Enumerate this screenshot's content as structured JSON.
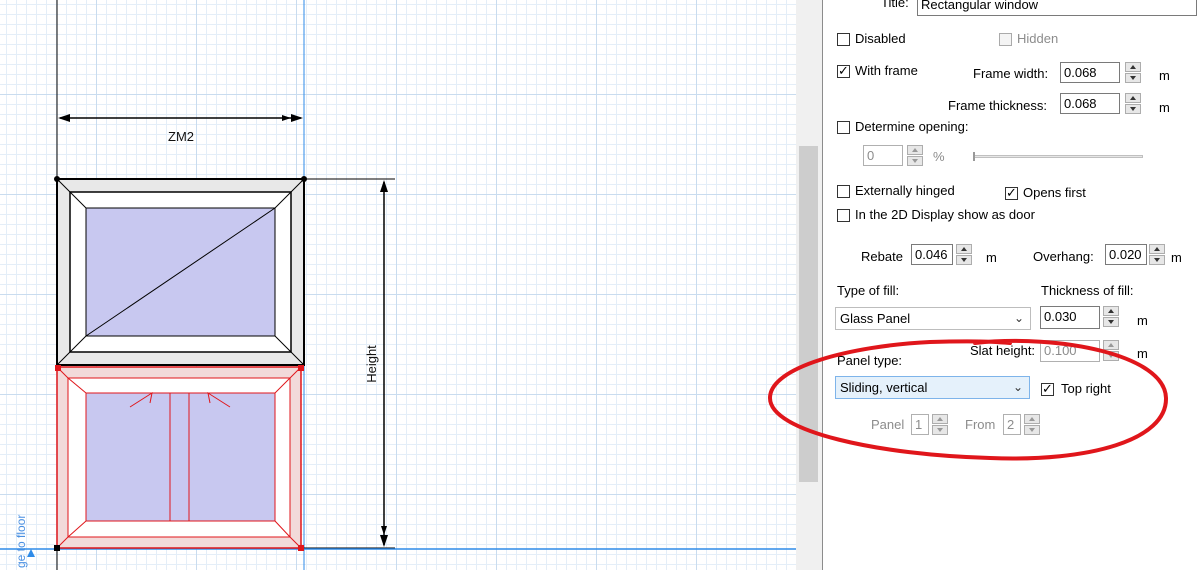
{
  "drawing": {
    "dimension_width_label": "ZM2",
    "dimension_height_label": "Height",
    "floor_label": "ge to floor"
  },
  "panel": {
    "title_label": "Title:",
    "title_value": "Rectangular window",
    "disabled": {
      "label": "Disabled",
      "checked": false
    },
    "hidden": {
      "label": "Hidden",
      "checked": false
    },
    "with_frame": {
      "label": "With frame",
      "checked": true
    },
    "frame_width": {
      "label": "Frame width:",
      "value": "0.068",
      "unit": "m"
    },
    "frame_thickness": {
      "label": "Frame thickness:",
      "value": "0.068",
      "unit": "m"
    },
    "determine_opening": {
      "label": "Determine opening:",
      "checked": false
    },
    "opening": {
      "value": "0",
      "unit": "%"
    },
    "externally_hinged": {
      "label": "Externally hinged",
      "checked": false
    },
    "opens_first": {
      "label": "Opens first",
      "checked": true
    },
    "show_as_door": {
      "label": "In the 2D Display show as door",
      "checked": false
    },
    "rebate": {
      "label": "Rebate",
      "value": "0.046",
      "unit": "m"
    },
    "overhang": {
      "label": "Overhang:",
      "value": "0.020",
      "unit": "m"
    },
    "type_of_fill": {
      "label": "Type of fill:",
      "selected": "Glass Panel"
    },
    "thickness_of_fill": {
      "label": "Thickness of fill:",
      "value": "0.030",
      "unit": "m"
    },
    "slat_height": {
      "label": "Slat height:",
      "value": "0.100",
      "unit": "m"
    },
    "panel_type": {
      "label": "Panel type:",
      "selected": "Sliding, vertical"
    },
    "top_right": {
      "label": "Top right",
      "checked": true
    },
    "panel_index": {
      "label": "Panel",
      "value": "1"
    },
    "panel_from": {
      "label": "From",
      "value": "2"
    }
  },
  "annotation": {
    "color": "#e0161b"
  },
  "colors": {
    "grid_major": "#c9dcef",
    "glass": "#c8c8f0",
    "selection": "#e0161b",
    "floor_line": "#2e8be8"
  }
}
